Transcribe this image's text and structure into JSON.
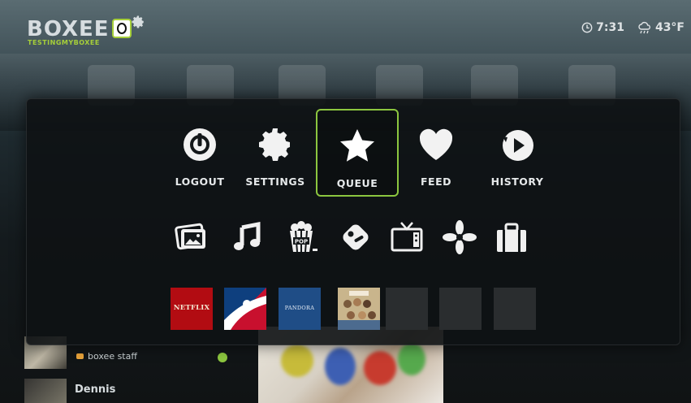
{
  "logo": {
    "brand": "BOXEE",
    "username": "TESTINGMYBOXEE"
  },
  "status": {
    "time": "7:31",
    "weather": "43°F"
  },
  "menu": [
    {
      "id": "logout",
      "label": "LOGOUT",
      "icon": "power-icon"
    },
    {
      "id": "settings",
      "label": "SETTINGS",
      "icon": "gear-icon"
    },
    {
      "id": "queue",
      "label": "QUEUE",
      "icon": "star-icon",
      "selected": true
    },
    {
      "id": "feed",
      "label": "FEED",
      "icon": "heart-icon"
    },
    {
      "id": "history",
      "label": "HISTORY",
      "icon": "history-icon"
    }
  ],
  "categories": [
    "photos-icon",
    "music-icon",
    "movies-popcorn-icon",
    "apps-icon",
    "tv-icon",
    "pinwheel-icon",
    "briefcase-icon"
  ],
  "apps": [
    {
      "name": "netflix",
      "text": "NETFLIX"
    },
    {
      "name": "mlb",
      "text": ""
    },
    {
      "name": "pandora",
      "text": "PANDORA"
    },
    {
      "name": "modern-family",
      "text": ""
    },
    {
      "name": "empty",
      "text": ""
    },
    {
      "name": "empty",
      "text": ""
    },
    {
      "name": "empty",
      "text": ""
    }
  ],
  "background_list": {
    "staff_label": "boxee staff",
    "name_label": "Dennis"
  },
  "colors": {
    "accent": "#8cc63f",
    "panel": "#0e1214"
  },
  "popcorn_text": "POP"
}
